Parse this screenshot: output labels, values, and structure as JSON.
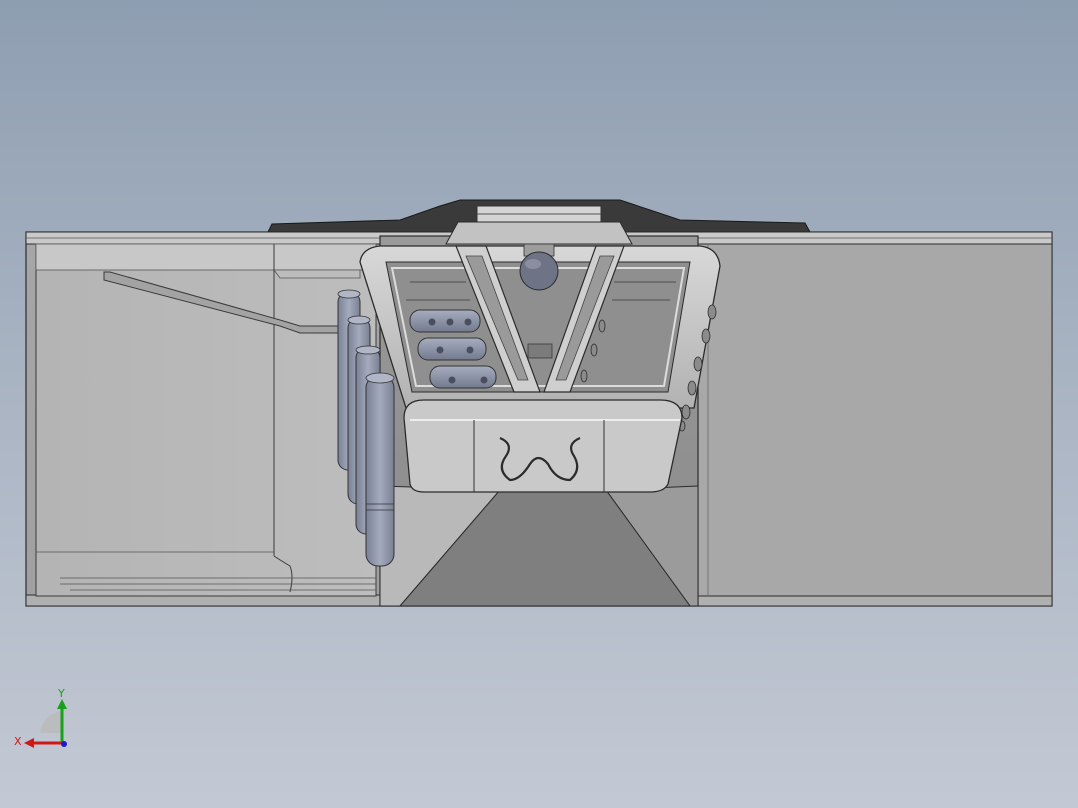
{
  "viewport": {
    "background_top": "#8e9eb1",
    "background_bottom": "#c3c9d4"
  },
  "model": {
    "body_color": "#a9a9a9",
    "frame_color": "#c4c4c4",
    "pin_color": "#8e95a8",
    "edge_color": "#2b2b2b",
    "dark_pad_color": "#3a3a3a"
  },
  "triad": {
    "x_label": "X",
    "y_label": "Y",
    "x_color": "#d01818",
    "y_color": "#1aa01a",
    "z_color": "#1a1ad0"
  }
}
